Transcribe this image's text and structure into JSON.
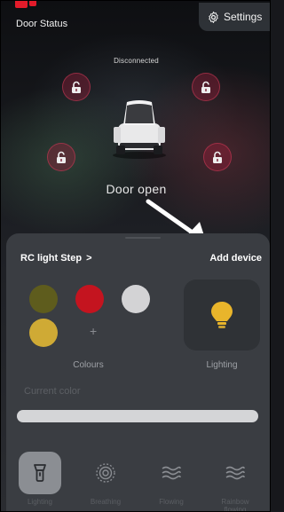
{
  "header": {
    "title": "Door Status",
    "settings_label": "Settings"
  },
  "vehicle": {
    "connection_status": "Disconnected",
    "door_status": "Door open",
    "locks": [
      "front-left",
      "front-right",
      "rear-left",
      "rear-right"
    ]
  },
  "sheet": {
    "rc_light_label": "RC light Step",
    "rc_light_chevron": ">",
    "add_device_label": "Add device",
    "colours_label": "Colours",
    "lighting_label": "Lighting",
    "current_color_label": "Current color",
    "current_color_hex": "#d4d5d7",
    "add_colour_glyph": "+",
    "swatches": [
      "#5e5c1d",
      "#c4141f",
      "#d3d3d5",
      "#cfaa35"
    ],
    "modes": [
      {
        "label": "Lighting",
        "icon": "flashlight-icon",
        "active": true
      },
      {
        "label": "Breathing",
        "icon": "ripple-icon",
        "active": false
      },
      {
        "label": "Flowing",
        "icon": "wave-icon",
        "active": false
      },
      {
        "label": "Rainbow flowing",
        "icon": "wave-icon",
        "active": false
      }
    ]
  },
  "colors": {
    "accent_lock": "#aa1e3c",
    "sheet_bg": "#3a3d42",
    "bulb": "#e9b52b"
  }
}
